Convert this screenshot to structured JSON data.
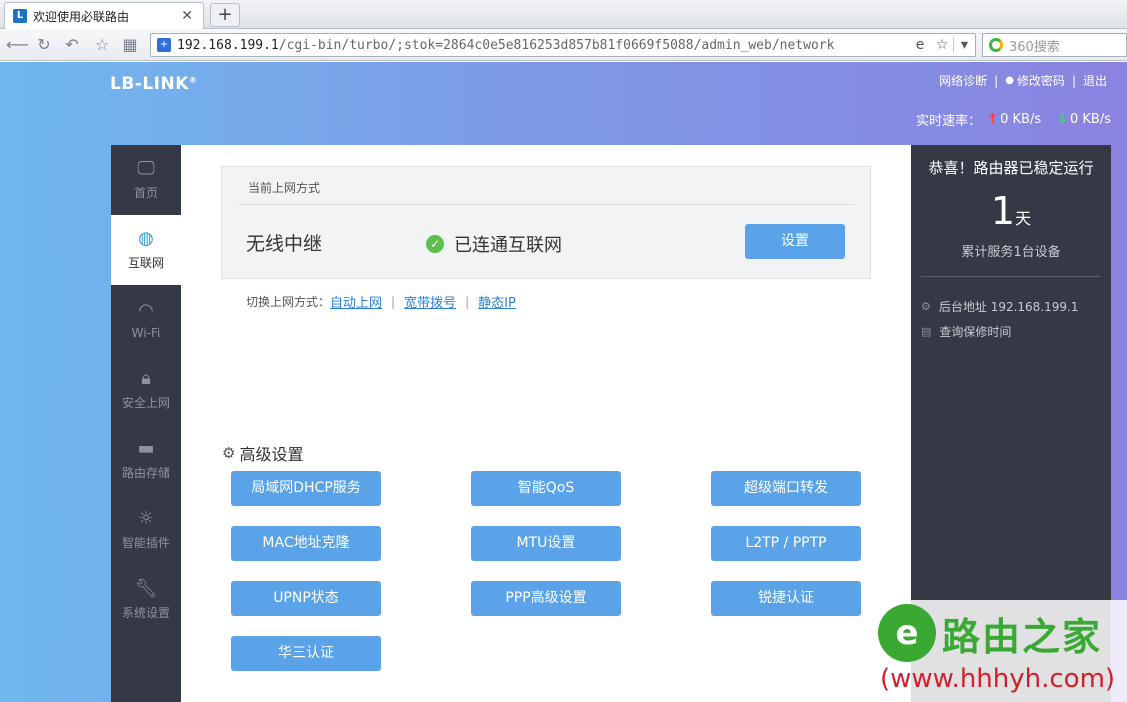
{
  "browser": {
    "tab_title": "欢迎使用必联路由",
    "tab_close": "✕",
    "new_tab": "+",
    "url_host": "192.168.199.1",
    "url_path": "/cgi-bin/turbo/;stok=2864c0e5e816253d857b81f0669f5088/admin_web/network",
    "search_placeholder": "360搜索"
  },
  "header": {
    "brand": "LB-LINK",
    "brand_mark": "®",
    "links": [
      "网络诊断",
      "修改密码",
      "退出"
    ],
    "rate_label": "实时速率：",
    "upload": "0 KB/s",
    "download": "0 KB/s"
  },
  "sidebar": {
    "items": [
      {
        "label": "首页",
        "icon": "monitor-icon"
      },
      {
        "label": "互联网",
        "icon": "globe-icon"
      },
      {
        "label": "Wi-Fi",
        "icon": "wifi-icon"
      },
      {
        "label": "安全上网",
        "icon": "lock-icon"
      },
      {
        "label": "路由存储",
        "icon": "folder-icon"
      },
      {
        "label": "智能插件",
        "icon": "bulb-icon"
      },
      {
        "label": "系统设置",
        "icon": "wrench-icon"
      }
    ],
    "active": "互联网"
  },
  "connection": {
    "title": "当前上网方式",
    "mode": "无线中继",
    "status": "已连通互联网",
    "setting_button": "设置",
    "switch_label": "切换上网方式：",
    "switch_options": [
      "自动上网",
      "宽带拨号",
      "静态IP"
    ]
  },
  "advanced": {
    "title": "高级设置",
    "buttons": [
      "局域网DHCP服务",
      "智能QoS",
      "超级端口转发",
      "MAC地址克隆",
      "MTU设置",
      "L2TP / PPTP",
      "UPNP状态",
      "PPP高级设置",
      "锐捷认证",
      "华三认证"
    ]
  },
  "status_panel": {
    "headline": "恭喜！路由器已稳定运行",
    "uptime_value": "1",
    "uptime_unit": "天",
    "served": "累计服务1台设备",
    "admin_address": "后台地址 192.168.199.1",
    "warranty": "查询保修时间"
  },
  "watermark": {
    "title": "路由之家",
    "url": "(www.hhhyh.com)"
  },
  "colors": {
    "accent_button": "#5aa3e8",
    "sidebar_bg": "#353945",
    "success_green": "#5cc04a",
    "upload_red": "#ff3b3b",
    "download_green": "#3ddc6a"
  }
}
